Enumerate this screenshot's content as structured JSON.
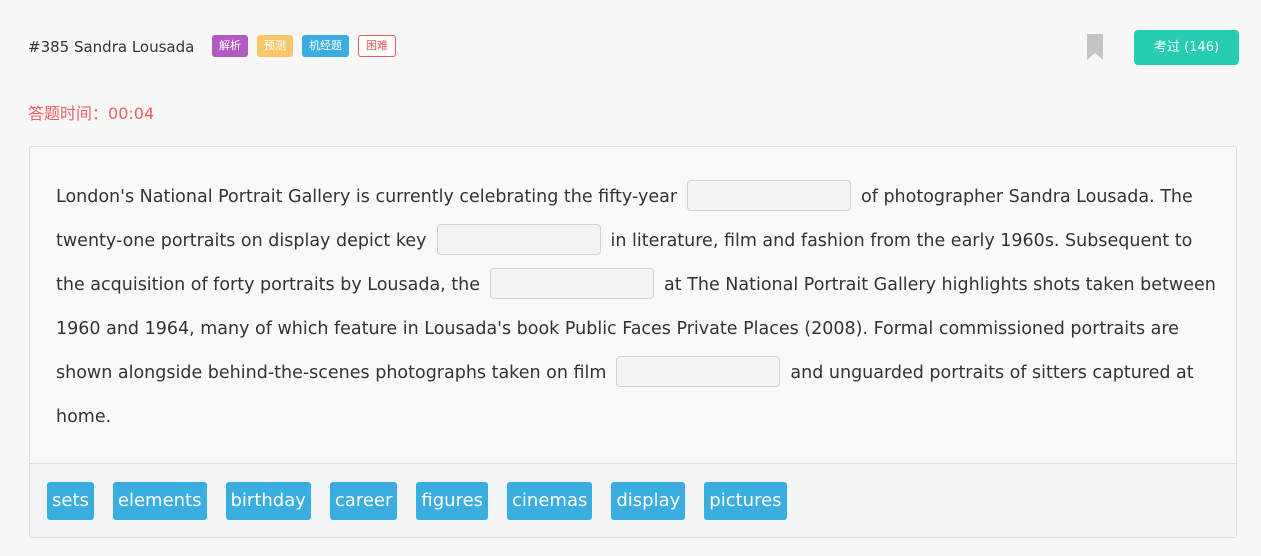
{
  "header": {
    "title": "#385 Sandra Lousada",
    "tags": [
      "解析",
      "预测",
      "机经题",
      "困难"
    ],
    "bookmark_icon": "bookmark-icon",
    "done_button": "考过 (146)"
  },
  "timer": {
    "label": "答题时间：",
    "value": "00:04"
  },
  "passage": {
    "segments": [
      "London's National Portrait Gallery is currently celebrating the fifty-year",
      "of photographer Sandra Lousada. The twenty-one portraits on display depict key",
      "in literature, film and fashion from the early 1960s. Subsequent to the acquisition of forty portraits by Lousada, the",
      "at The National Portrait Gallery highlights shots taken between 1960 and 1964, many of which feature in Lousada's book Public Faces Private Places (2008). Formal commissioned portraits are shown alongside behind-the-scenes photographs taken on film",
      "and unguarded portraits of sitters captured at home."
    ]
  },
  "options": [
    "sets",
    "elements",
    "birthday",
    "career",
    "figures",
    "cinemas",
    "display",
    "pictures"
  ],
  "colors": {
    "accent_teal": "#27cdb0",
    "option_blue": "#3aaee0",
    "timer_red": "#f06060",
    "tag_purple": "#b35ac2",
    "tag_yellow": "#f9c66c"
  }
}
